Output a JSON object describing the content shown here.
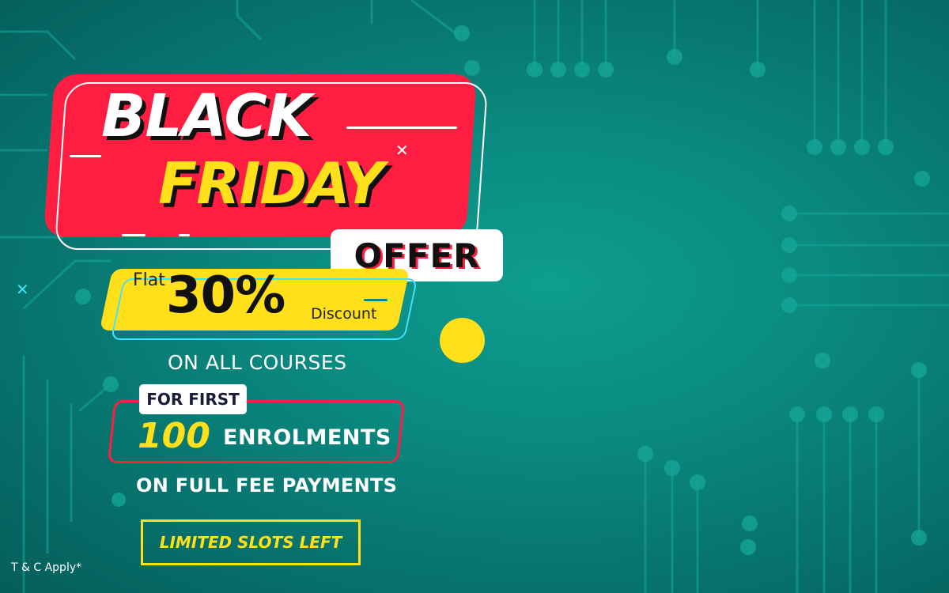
{
  "banner": {
    "headline_line1": "BLACK",
    "headline_line2": "FRIDAY",
    "offer_label": "OFFER",
    "flat_label": "Flat",
    "discount_value": "30%",
    "discount_label": "Discount",
    "courses_text": "ON ALL COURSES",
    "for_first_label": "FOR FIRST",
    "enrolment_count": "100",
    "enrolment_label": "ENROLMENTS",
    "payment_text": "ON FULL FEE PAYMENTS",
    "cta_label": "LIMITED SLOTS LEFT",
    "terms_text": "T & C Apply*"
  },
  "colors": {
    "background": "#0a8a80",
    "red": "#ff1e42",
    "yellow": "#ffe01b",
    "cyan": "#3fe3ff",
    "white": "#ffffff"
  },
  "icons": [
    "close-cross-icon",
    "close-cross-icon"
  ]
}
